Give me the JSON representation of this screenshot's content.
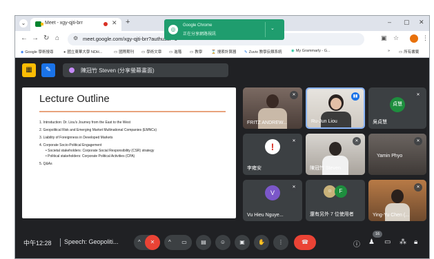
{
  "browser": {
    "tab_title": "Meet - xgy-qjti-brr",
    "tab_close": "✕",
    "new_tab": "+",
    "url": "meet.google.com/xgy-qjti-brr?authuser=0",
    "window_controls": [
      "–",
      "▢",
      "✕"
    ],
    "bookmarks": [
      "Google 學術搜尋",
      "國立東華大學 NDH...",
      "國際期刊",
      "學術文章",
      "進階",
      "教學",
      "搜索計算器",
      "Zuvio 教學反饋系統",
      "My Grammarly - G...",
      "所有書籤"
    ]
  },
  "notification": {
    "title": "Google Chrome",
    "subtitle": "正在分享網路視訊"
  },
  "meet": {
    "presenter": "陳冠竹 Steven (分享螢幕畫面)",
    "slide": {
      "title": "Lecture Outline",
      "items": [
        "1.   Introduction: Dr. Liou's Journey from the East to the West",
        "2.   Geopolitical Risk and Emerging Market Multinational Companies (EMNCs)",
        "3.   Liability of Foreignness in Developed Markets",
        "4.   Corporate Socio-Political Engagement",
        "•  Societal stakeholders: Corporate Social Responsibility (CSR) strategy",
        "•  Political stakeholders: Corporate Political Activities (CPA)",
        "5.   Q&As"
      ]
    },
    "tiles": [
      {
        "name": "FRITZ ANDREW..."
      },
      {
        "name": "Ru-Jun Liou"
      },
      {
        "name": "吳貞慧",
        "avatar": "貞慧"
      },
      {
        "name": "李雍安"
      },
      {
        "name": "陳冠竹 Steven"
      },
      {
        "name": "Yamin Phyo"
      },
      {
        "name": "Vu Hieu Nguye...",
        "avatar": "V"
      },
      {
        "name": "還有另外 7 位使用者",
        "avatar": "F"
      },
      {
        "name": "Ying-Yu Chen (..."
      }
    ],
    "time": "中午12:28",
    "meeting_title": "Speech: Geopoliti...",
    "participant_count": "16",
    "colors": {
      "background": "#202124",
      "tile": "#3c4043",
      "end_call": "#ea4335",
      "accent_blue": "#8ab4f8"
    }
  }
}
